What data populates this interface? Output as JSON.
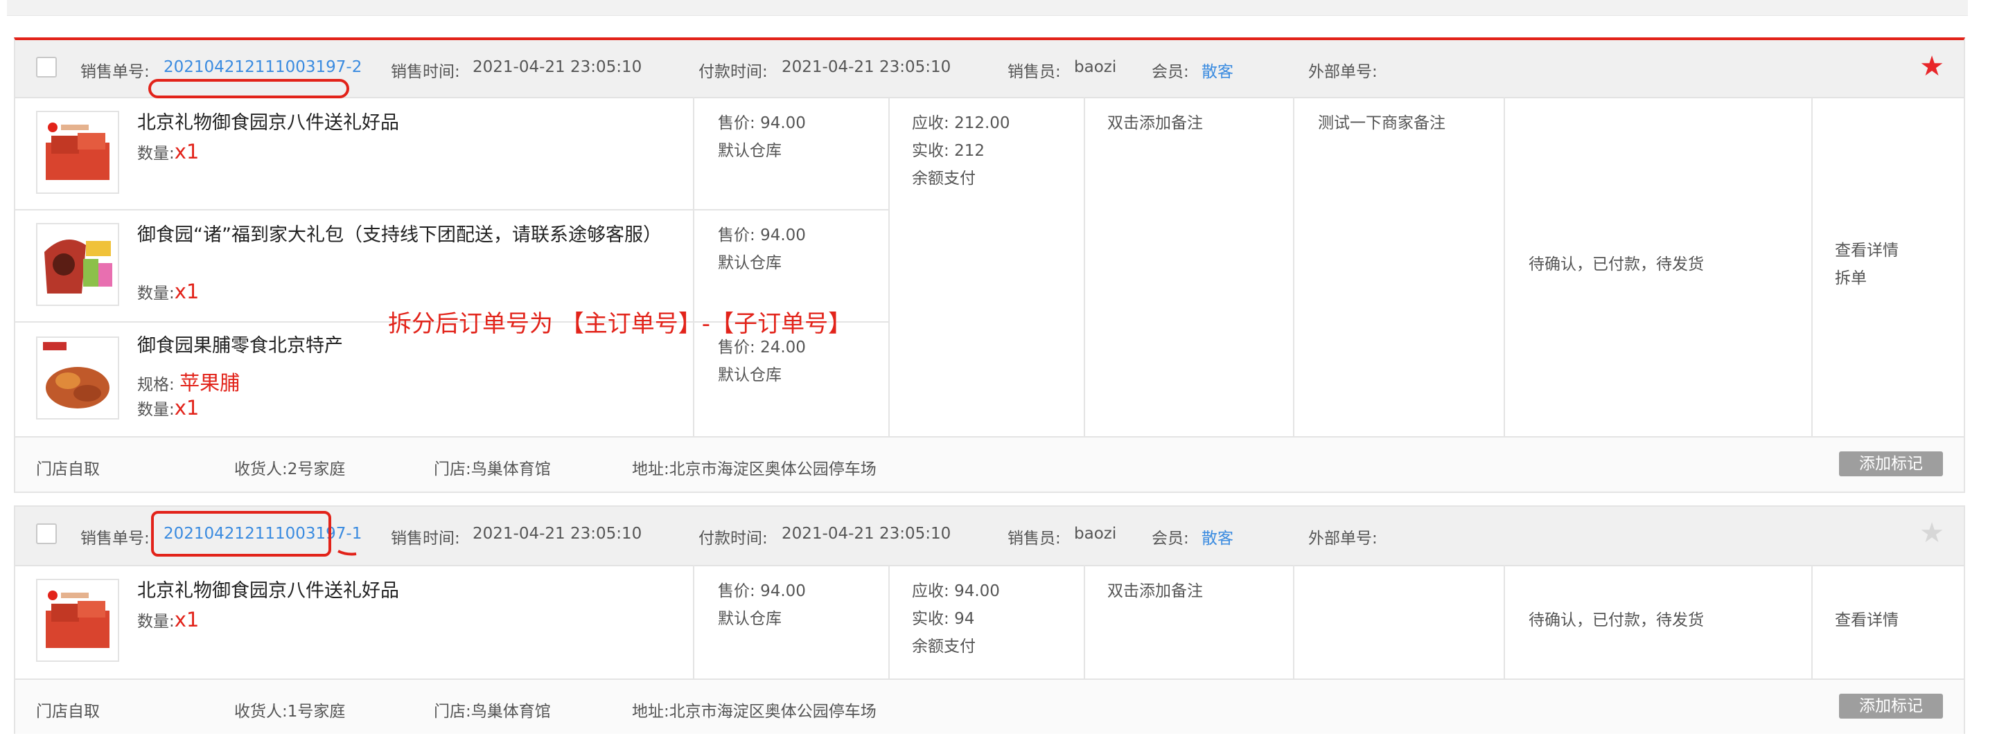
{
  "labels": {
    "order_no": "销售单号:",
    "sale_time": "销售时间:",
    "pay_time": "付款时间:",
    "seller": "销售员:",
    "member": "会员:",
    "external_no": "外部单号:",
    "price": "售价:",
    "qty": "数量:",
    "spec": "规格:",
    "receivable": "应收:",
    "received": "实收:",
    "receiver": "收货人:",
    "store": "门店:",
    "address": "地址:"
  },
  "orders": [
    {
      "order_no": "202104212111003197-2",
      "sale_time": "2021-04-21 23:05:10",
      "pay_time": "2021-04-21 23:05:10",
      "seller": "baozi",
      "member": "散客",
      "starred": true,
      "items": [
        {
          "name": "北京礼物御食园京八件送礼好品",
          "qty": "x1",
          "price": "94.00",
          "warehouse": "默认仓库"
        },
        {
          "name": "御食园“诸”福到家大礼包（支持线下团配送，请联系途够客服）",
          "qty": "x1",
          "price": "94.00",
          "warehouse": "默认仓库"
        },
        {
          "name": "御食园果脯零食北京特产",
          "spec": "苹果脯",
          "qty": "x1",
          "price": "24.00",
          "warehouse": "默认仓库"
        }
      ],
      "receivable": "212.00",
      "received": "212",
      "pay_method": "余额支付",
      "remark": "双击添加备注",
      "merchant_remark": "测试一下商家备注",
      "status": "待确认，已付款，待发货",
      "actions": [
        "查看详情",
        "拆单"
      ],
      "delivery": "门店自取",
      "receiver": "2号家庭",
      "store": "鸟巢体育馆",
      "address": "北京市海淀区奥体公园停车场",
      "tag_button": "添加标记"
    },
    {
      "order_no": "202104212111003197-1",
      "sale_time": "2021-04-21 23:05:10",
      "pay_time": "2021-04-21 23:05:10",
      "seller": "baozi",
      "member": "散客",
      "starred": false,
      "items": [
        {
          "name": "北京礼物御食园京八件送礼好品",
          "qty": "x1",
          "price": "94.00",
          "warehouse": "默认仓库"
        }
      ],
      "receivable": "94.00",
      "received": "94",
      "pay_method": "余额支付",
      "remark": "双击添加备注",
      "merchant_remark": "",
      "status": "待确认，已付款，待发货",
      "actions": [
        "查看详情"
      ],
      "delivery": "门店自取",
      "receiver": "1号家庭",
      "store": "鸟巢体育馆",
      "address": "北京市海淀区奥体公园停车场",
      "tag_button": "添加标记"
    }
  ],
  "annotation": "拆分后订单号为 【主订单号】-【子订单号】",
  "colors": {
    "accent_red": "#e2231a",
    "link_blue": "#3a8be0",
    "star_on": "#e8262a",
    "star_off": "#d7d7d7"
  },
  "icons": {
    "checkbox": "checkbox-icon",
    "star": "star-icon",
    "product": "product-thumbnail"
  }
}
